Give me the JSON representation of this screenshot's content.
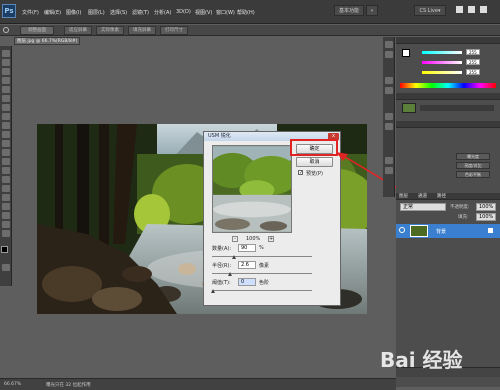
{
  "app": {
    "logo": "Ps"
  },
  "menu": [
    "文件(F)",
    "编辑(E)",
    "图像(I)",
    "图层(L)",
    "选择(S)",
    "滤镜(T)",
    "分析(A)",
    "3D(D)",
    "视图(V)",
    "窗口(W)",
    "帮助(H)"
  ],
  "workspace": {
    "essentials": "基本功能",
    "cs_live": "CS Live▾"
  },
  "options": {
    "preset_label": "调整画面",
    "btn1": "适应屏幕",
    "btn2": "实际像素",
    "btn3": "填充屏幕",
    "btn4": "打印尺寸"
  },
  "document": {
    "tab_title": "图层.jpg @ 66.7%(RGB/8#)",
    "zoom": "66.67%",
    "doc_info": "曝光只在 32 位起作用"
  },
  "dialog": {
    "title": "USM 锐化",
    "close": "x",
    "ok_label": "确定",
    "cancel_label": "取消",
    "preview_label": "预览(P)",
    "preview_checked": true,
    "zoom_pct": "100%",
    "zoom_out": "-",
    "zoom_in": "+",
    "amount_label": "数量(A):",
    "amount_value": "90",
    "amount_unit": "%",
    "radius_label": "半径(R):",
    "radius_value": "2.6",
    "radius_unit": "像素",
    "threshold_label": "阈值(T):",
    "threshold_value": "0",
    "threshold_unit": "色阶"
  },
  "panels": {
    "color_values": [
      "255",
      "255",
      "255"
    ],
    "adjust_btn1": "曝光度",
    "adjust_btn2": "亮度/对比",
    "adjust_btn3": "色彩平衡",
    "layers_tabs": [
      "图层",
      "通道",
      "路径"
    ],
    "blend_mode": "正常",
    "opacity_label": "不透明度:",
    "opacity_value": "100%",
    "fill_label": "填充:",
    "fill_value": "100%",
    "layer_name": "背景"
  },
  "watermark": "Bai 经验"
}
